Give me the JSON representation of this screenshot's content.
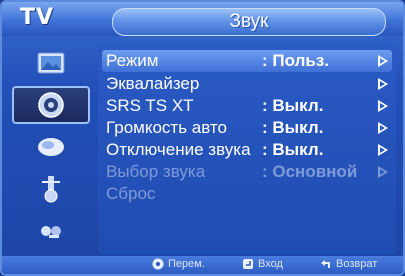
{
  "header": {
    "tv_label": "TV",
    "title": "Звук"
  },
  "sidebar": {
    "items": [
      {
        "icon": "picture-icon"
      },
      {
        "icon": "sound-icon",
        "active": true
      },
      {
        "icon": "channel-icon"
      },
      {
        "icon": "setup-icon"
      },
      {
        "icon": "input-icon"
      }
    ]
  },
  "menu": {
    "items": [
      {
        "label": "Режим",
        "value": ": Польз.",
        "arrow": true,
        "selected": true
      },
      {
        "label": "Эквалайзер",
        "value": "",
        "arrow": true
      },
      {
        "label": "SRS TS XT",
        "value": ": Выкл.",
        "arrow": true
      },
      {
        "label": "Громкость авто",
        "value": ": Выкл.",
        "arrow": true
      },
      {
        "label": "Отключение звука",
        "value": ": Выкл.",
        "arrow": true
      },
      {
        "label": "Выбор звука",
        "value": ": Основной",
        "arrow": true,
        "disabled": true
      },
      {
        "label": "Сброс",
        "value": "",
        "arrow": false,
        "disabled": true
      }
    ]
  },
  "footer": {
    "move": "Перем.",
    "enter": "Вход",
    "back": "Возврат"
  }
}
